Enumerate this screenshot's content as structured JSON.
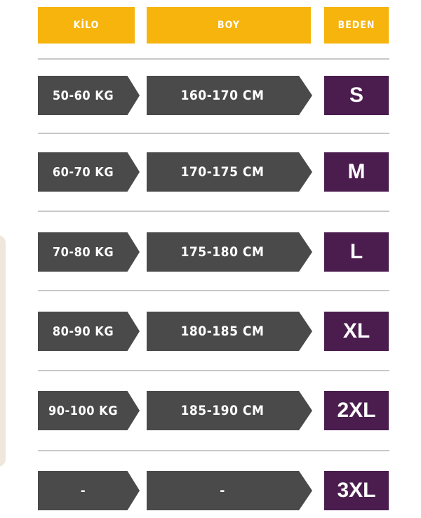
{
  "headers": {
    "kilo": "KİLO",
    "boy": "BOY",
    "beden": "BEDEN"
  },
  "rows": [
    {
      "kilo": "50-60 KG",
      "boy": "160-170 CM",
      "beden": "S"
    },
    {
      "kilo": "60-70 KG",
      "boy": "170-175 CM",
      "beden": "M"
    },
    {
      "kilo": "70-80 KG",
      "boy": "175-180 CM",
      "beden": "L"
    },
    {
      "kilo": "80-90 KG",
      "boy": "180-185 CM",
      "beden": "XL"
    },
    {
      "kilo": "90-100 KG",
      "boy": "185-190 CM",
      "beden": "2XL"
    },
    {
      "kilo": "-",
      "boy": "-",
      "beden": "3XL"
    }
  ],
  "colors": {
    "header": "#f6b40d",
    "cell": "#4a4a4a",
    "size": "#4b1d4f"
  }
}
